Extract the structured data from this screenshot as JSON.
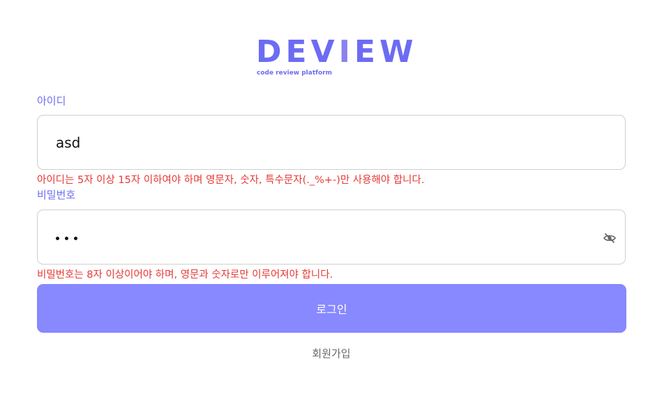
{
  "logo": {
    "word_prefix": "DEV",
    "word_accent": "I",
    "word_suffix": "EW",
    "tagline": "code review platform"
  },
  "username": {
    "label": "아이디",
    "value": "asd",
    "error": "아이디는 5자 이상 15자 이하여야 하며 영문자, 숫자, 특수문자(._%+-)만 사용해야 합니다."
  },
  "password": {
    "label": "비밀번호",
    "masked_length": 3,
    "toggle_icon": "eye-off-icon",
    "error": "비밀번호는 8자 이상이어야 하며, 영문과 숫자로만 이루어져야 합니다."
  },
  "login_button": {
    "label": "로그인"
  },
  "signup_link": {
    "label": "회원가입"
  },
  "colors": {
    "brand": "#6c6cf3",
    "button": "#8888ff",
    "error": "#e53935",
    "border": "#cfcfcf"
  }
}
